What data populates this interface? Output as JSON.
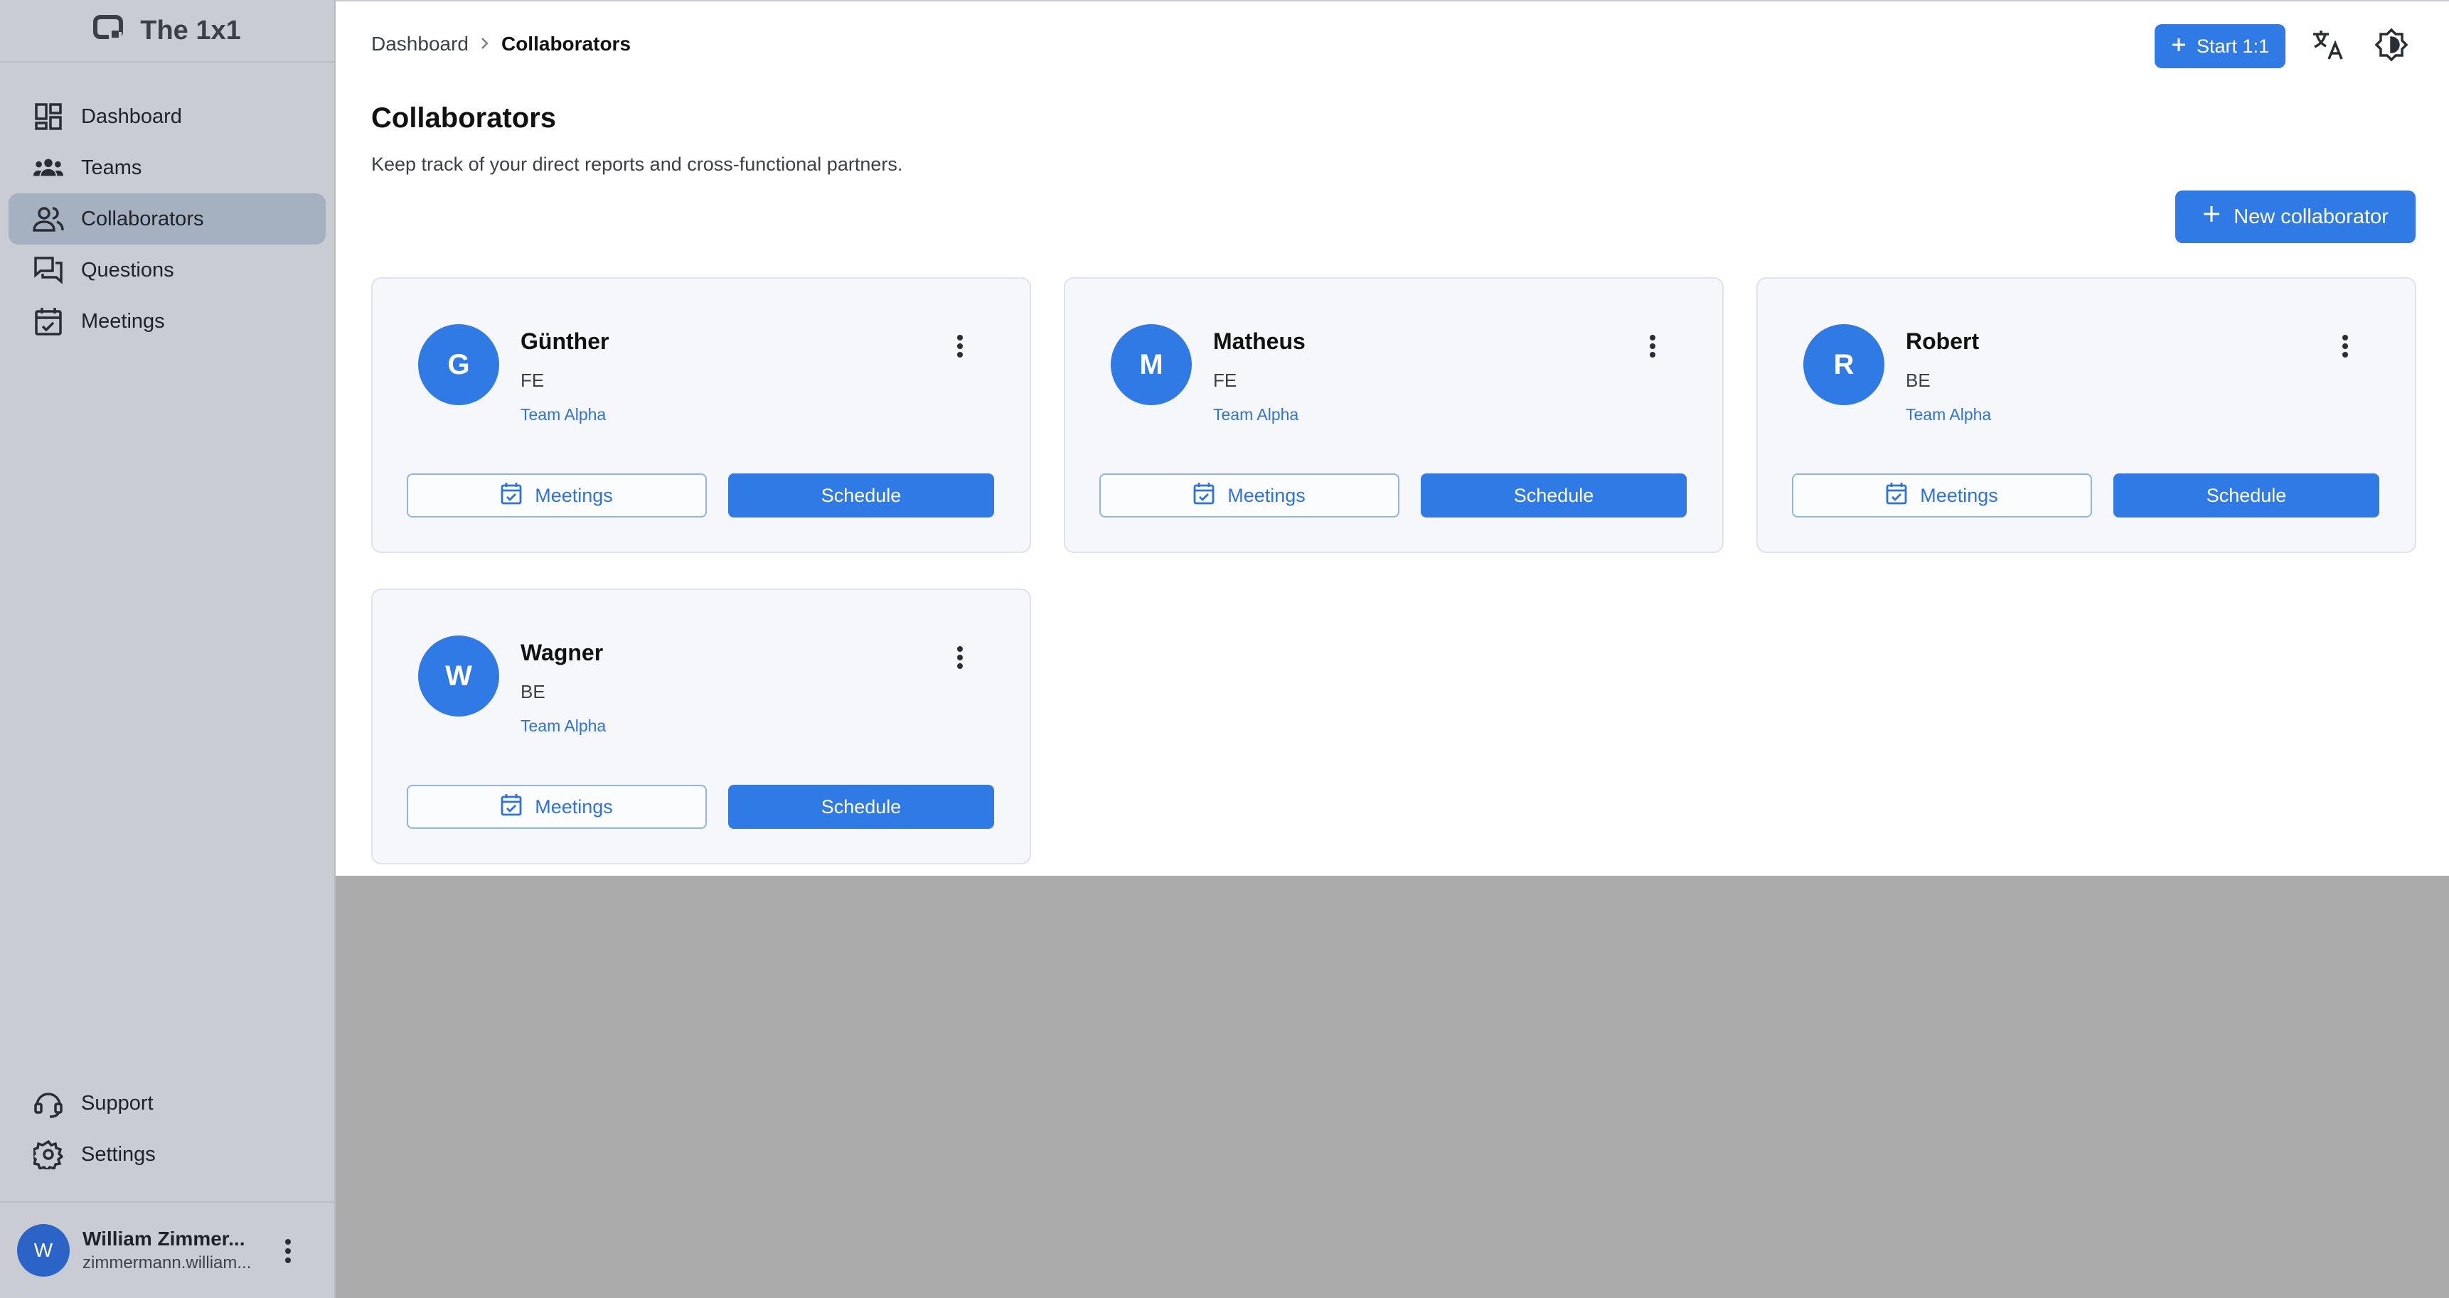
{
  "app": {
    "name": "The 1x1"
  },
  "sidebar": {
    "items": [
      {
        "label": "Dashboard",
        "icon": "dashboard-icon",
        "active": false
      },
      {
        "label": "Teams",
        "icon": "teams-icon",
        "active": false
      },
      {
        "label": "Collaborators",
        "icon": "collaborators-icon",
        "active": true
      },
      {
        "label": "Questions",
        "icon": "questions-icon",
        "active": false
      },
      {
        "label": "Meetings",
        "icon": "calendar-icon",
        "active": false
      }
    ],
    "bottom": [
      {
        "label": "Support",
        "icon": "support-icon"
      },
      {
        "label": "Settings",
        "icon": "gear-icon"
      }
    ]
  },
  "user": {
    "initial": "W",
    "name": "William Zimmer...",
    "email": "zimmermann.william..."
  },
  "breadcrumb": {
    "root": "Dashboard",
    "current": "Collaborators"
  },
  "header": {
    "start_label": "Start 1:1"
  },
  "page": {
    "title": "Collaborators",
    "subtitle": "Keep track of your direct reports and cross-functional partners.",
    "new_label": "New collaborator"
  },
  "collaborators": [
    {
      "initial": "G",
      "name": "Günther",
      "role": "FE",
      "team": "Team Alpha"
    },
    {
      "initial": "M",
      "name": "Matheus",
      "role": "FE",
      "team": "Team Alpha"
    },
    {
      "initial": "R",
      "name": "Robert",
      "role": "BE",
      "team": "Team Alpha"
    },
    {
      "initial": "W",
      "name": "Wagner",
      "role": "BE",
      "team": "Team Alpha"
    }
  ],
  "card_actions": {
    "meetings_label": "Meetings",
    "schedule_label": "Schedule"
  },
  "colors": {
    "primary": "#2f7ae5",
    "sidebar_bg": "#c9cdd3",
    "active_item": "#a5b0c1",
    "overlay": "#ababab"
  }
}
